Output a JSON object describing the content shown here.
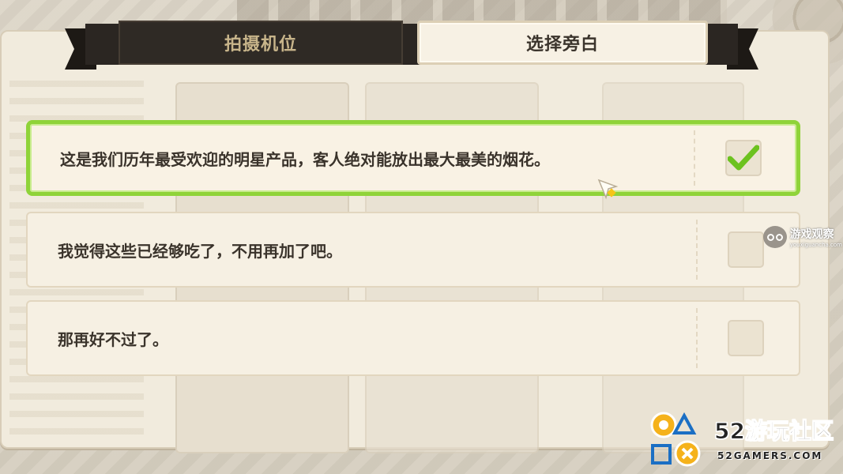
{
  "tabs": {
    "camera_label": "拍摄机位",
    "narration_label": "选择旁白",
    "active": "narration"
  },
  "options": [
    {
      "text": "这是我们历年最受欢迎的明星产品，客人绝对能放出最大最美的烟花。",
      "selected": true
    },
    {
      "text": "我觉得这些已经够吃了，不用再加了吧。",
      "selected": false
    },
    {
      "text": "那再好不过了。",
      "selected": false
    }
  ],
  "colors": {
    "selected_border": "#8fd339",
    "check_mark": "#6cc21f",
    "panel_bg": "#f1ebdd",
    "dark_tab": "#2b2622"
  },
  "icons": {
    "check": "check-icon",
    "cursor": "cursor-sparkle-icon"
  },
  "watermarks": {
    "youxi_main": "游戏观察",
    "youxi_sub": "youxiguancha.com",
    "gamers_title": "52游玩社区",
    "gamers_url": "52GAMERS.COM"
  }
}
